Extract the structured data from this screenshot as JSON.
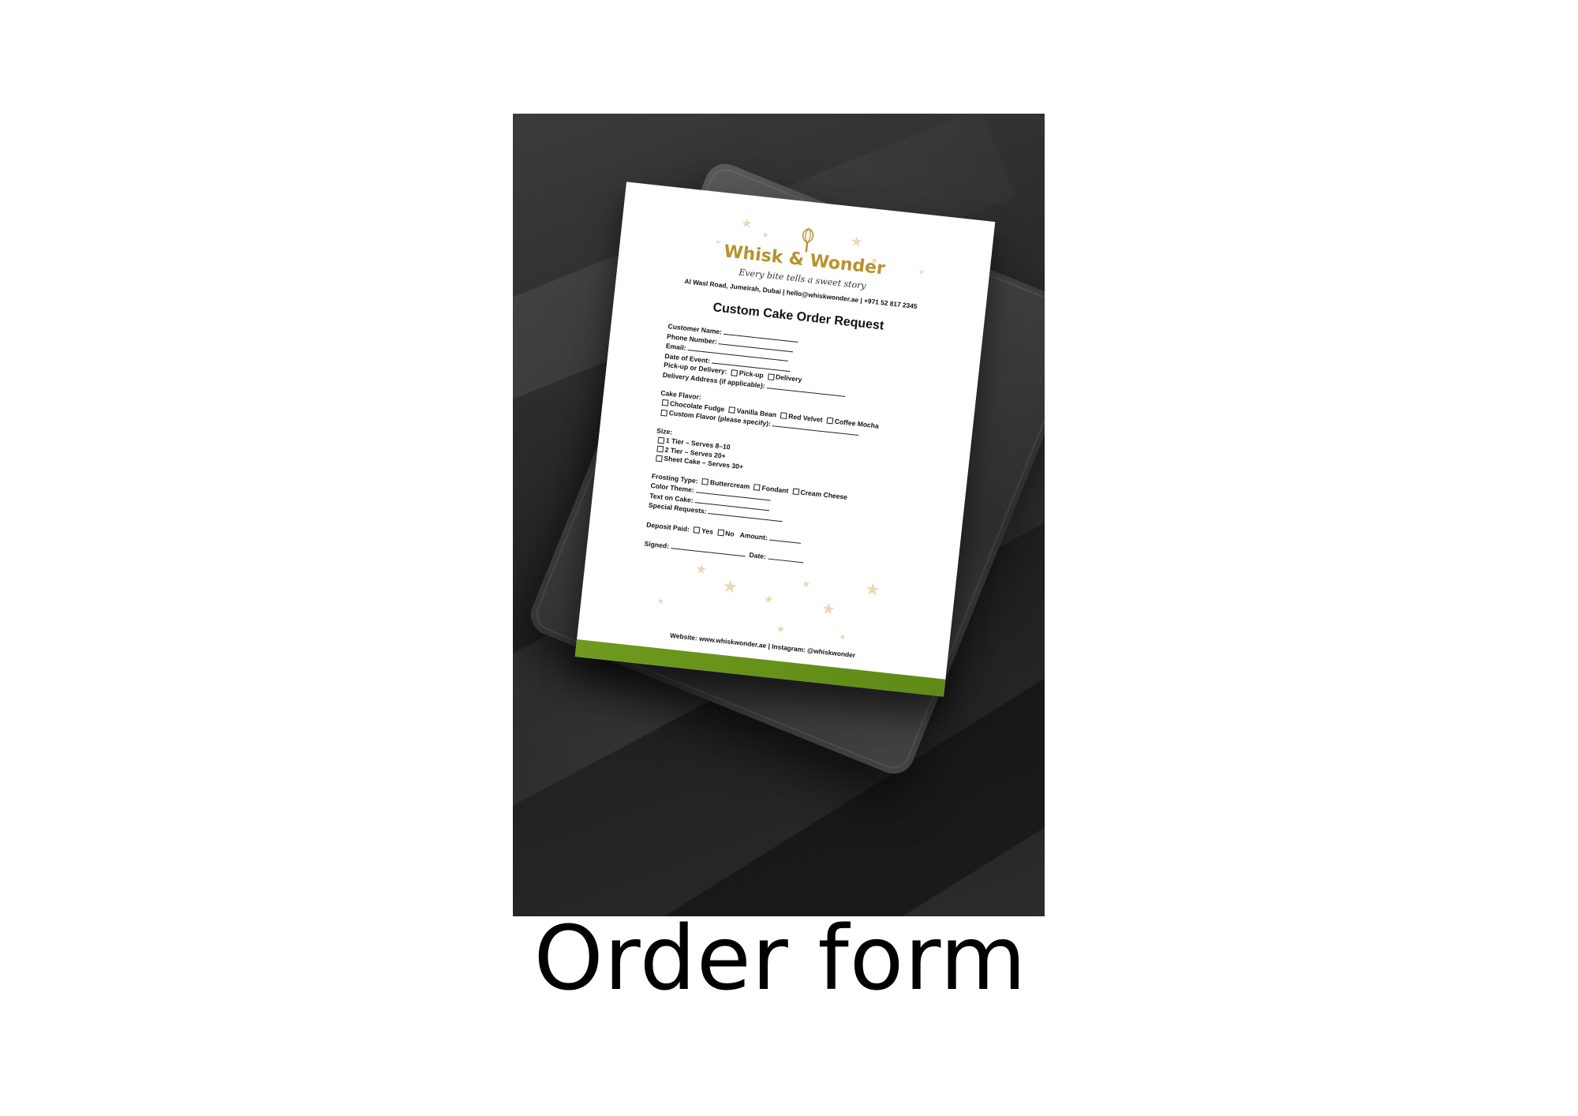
{
  "caption": "Order form",
  "colors": {
    "brand_gold": "#b8922e",
    "band_green": "#6f9a1f",
    "photo_background": "#2a2a2a"
  },
  "icons": [
    "whisk-icon",
    "star-icon"
  ],
  "document": {
    "brand_name": "Whisk & Wonder",
    "tagline": "Every bite tells a sweet story",
    "address_line": "Al Wasl Road, Jumeirah, Dubai | hello@whiskwonder.ae | +971 52 817 2345",
    "form_title": "Custom Cake Order Request",
    "fields": {
      "customer_name": "Customer Name:",
      "phone_number": "Phone Number:",
      "email": "Email:",
      "date_of_event": "Date of Event:",
      "pickup_or_delivery": "Pick-up or Delivery:",
      "pickup_option": "Pick-up",
      "delivery_option": "Delivery",
      "delivery_address": "Delivery Address (if applicable):"
    },
    "cake_flavor": {
      "label": "Cake Flavor:",
      "options": [
        "Chocolate Fudge",
        "Vanilla Bean",
        "Red Velvet",
        "Coffee Mocha"
      ],
      "custom": "Custom Flavor (please specify):"
    },
    "size": {
      "label": "Size:",
      "options": [
        "1 Tier – Serves 8–10",
        "2 Tier – Serves 20+",
        "Sheet Cake – Serves 30+"
      ]
    },
    "frosting": {
      "label": "Frosting Type:",
      "options": [
        "Buttercream",
        "Fondant",
        "Cream Cheese"
      ]
    },
    "extra_fields": {
      "color_theme": "Color Theme:",
      "text_on_cake": "Text on Cake:",
      "special_requests": "Special Requests:"
    },
    "deposit": {
      "label": "Deposit Paid:",
      "yes": "Yes",
      "no": "No",
      "amount": "Amount:"
    },
    "signature": {
      "signed": "Signed:",
      "date": "Date:"
    },
    "footer": "Website: www.whiskwonder.ae | Instagram: @whiskwonder"
  }
}
